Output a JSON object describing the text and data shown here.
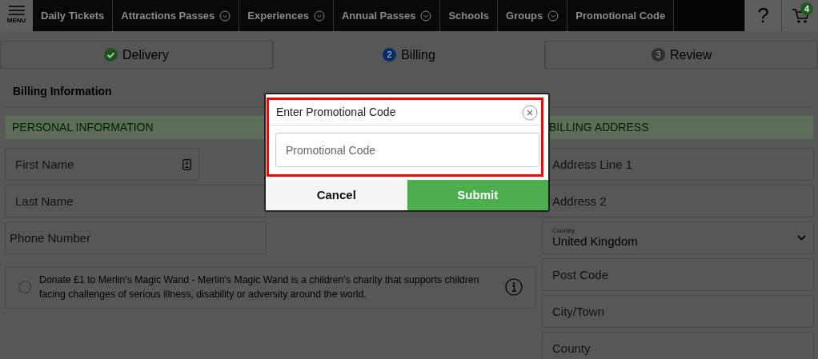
{
  "nav": {
    "menu_label": "MENU",
    "items": [
      {
        "label": "Daily Tickets",
        "dropdown": false
      },
      {
        "label": "Attractions Passes",
        "dropdown": true
      },
      {
        "label": "Experiences",
        "dropdown": true
      },
      {
        "label": "Annual Passes",
        "dropdown": true
      },
      {
        "label": "Schools",
        "dropdown": false
      },
      {
        "label": "Groups",
        "dropdown": true
      },
      {
        "label": "Promotional Code",
        "dropdown": false
      }
    ],
    "help": "?",
    "cart_count": "4"
  },
  "steps": [
    {
      "label": "Delivery",
      "completed": true,
      "selected": false
    },
    {
      "label": "Billing",
      "number": "2",
      "completed": false,
      "selected": true
    },
    {
      "label": "Review",
      "number": "3",
      "completed": false,
      "selected": false
    }
  ],
  "section_title": "Billing Information",
  "personal": {
    "heading": "PERSONAL INFORMATION",
    "fields": [
      {
        "placeholder": "First Name",
        "autofill_icon": true
      },
      {
        "placeholder": "Last Name"
      },
      {
        "placeholder": "Phone Number"
      }
    ]
  },
  "donation": {
    "checked": false,
    "text": "Donate £1 to Merlin's Magic Wand - Merlin's Magic Wand is a children's charity that supports children facing challenges of serious illness, disability or adversity around the world."
  },
  "billing": {
    "heading": "BILLING ADDRESS",
    "fields": [
      {
        "kind": "text",
        "placeholder": "Address Line 1"
      },
      {
        "kind": "text",
        "placeholder": "Address 2"
      },
      {
        "kind": "select",
        "label": "Country",
        "value": "United Kingdom"
      },
      {
        "kind": "text",
        "placeholder": "Post Code"
      },
      {
        "kind": "text",
        "placeholder": "City/Town"
      },
      {
        "kind": "text",
        "placeholder": "County"
      }
    ]
  },
  "modal": {
    "title": "Enter Promotional Code",
    "placeholder": "Promotional Code",
    "buttons": [
      {
        "label": "Cancel",
        "kind": "secondary"
      },
      {
        "label": "Submit",
        "kind": "primary"
      }
    ]
  }
}
